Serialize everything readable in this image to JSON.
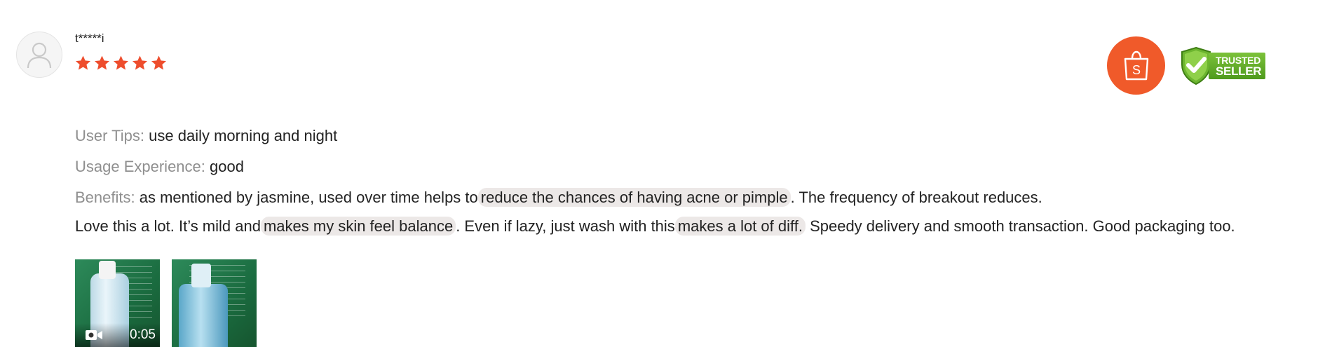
{
  "review": {
    "username": "t*****i",
    "rating": 5,
    "details": [
      {
        "label": "User Tips:",
        "value": "use daily morning and night"
      },
      {
        "label": "Usage Experience:",
        "value": "good"
      },
      {
        "label": "Benefits:",
        "value_before": "as mentioned by jasmine, used over time helps to",
        "value_highlight": "reduce the chances of having acne or pimple",
        "value_after": ". The frequency of breakout reduces."
      }
    ],
    "comment": {
      "part1": "Love this a lot. It’s mild and",
      "highlight1": "makes my skin feel balance",
      "part2": ". Even if lazy, just wash with this",
      "highlight2": "makes a lot of diff.",
      "part3": " Speedy delivery and smooth transaction. Good packaging too."
    },
    "media": {
      "video_duration": "0:05"
    }
  },
  "badges": {
    "shopee_letter": "S",
    "trusted_line1": "TRUSTED",
    "trusted_line2": "SELLER"
  },
  "colors": {
    "star": "#ee4d2d",
    "shopee": "#f05a2a",
    "highlight": "#ece8e7",
    "label": "#8f8f8f"
  }
}
